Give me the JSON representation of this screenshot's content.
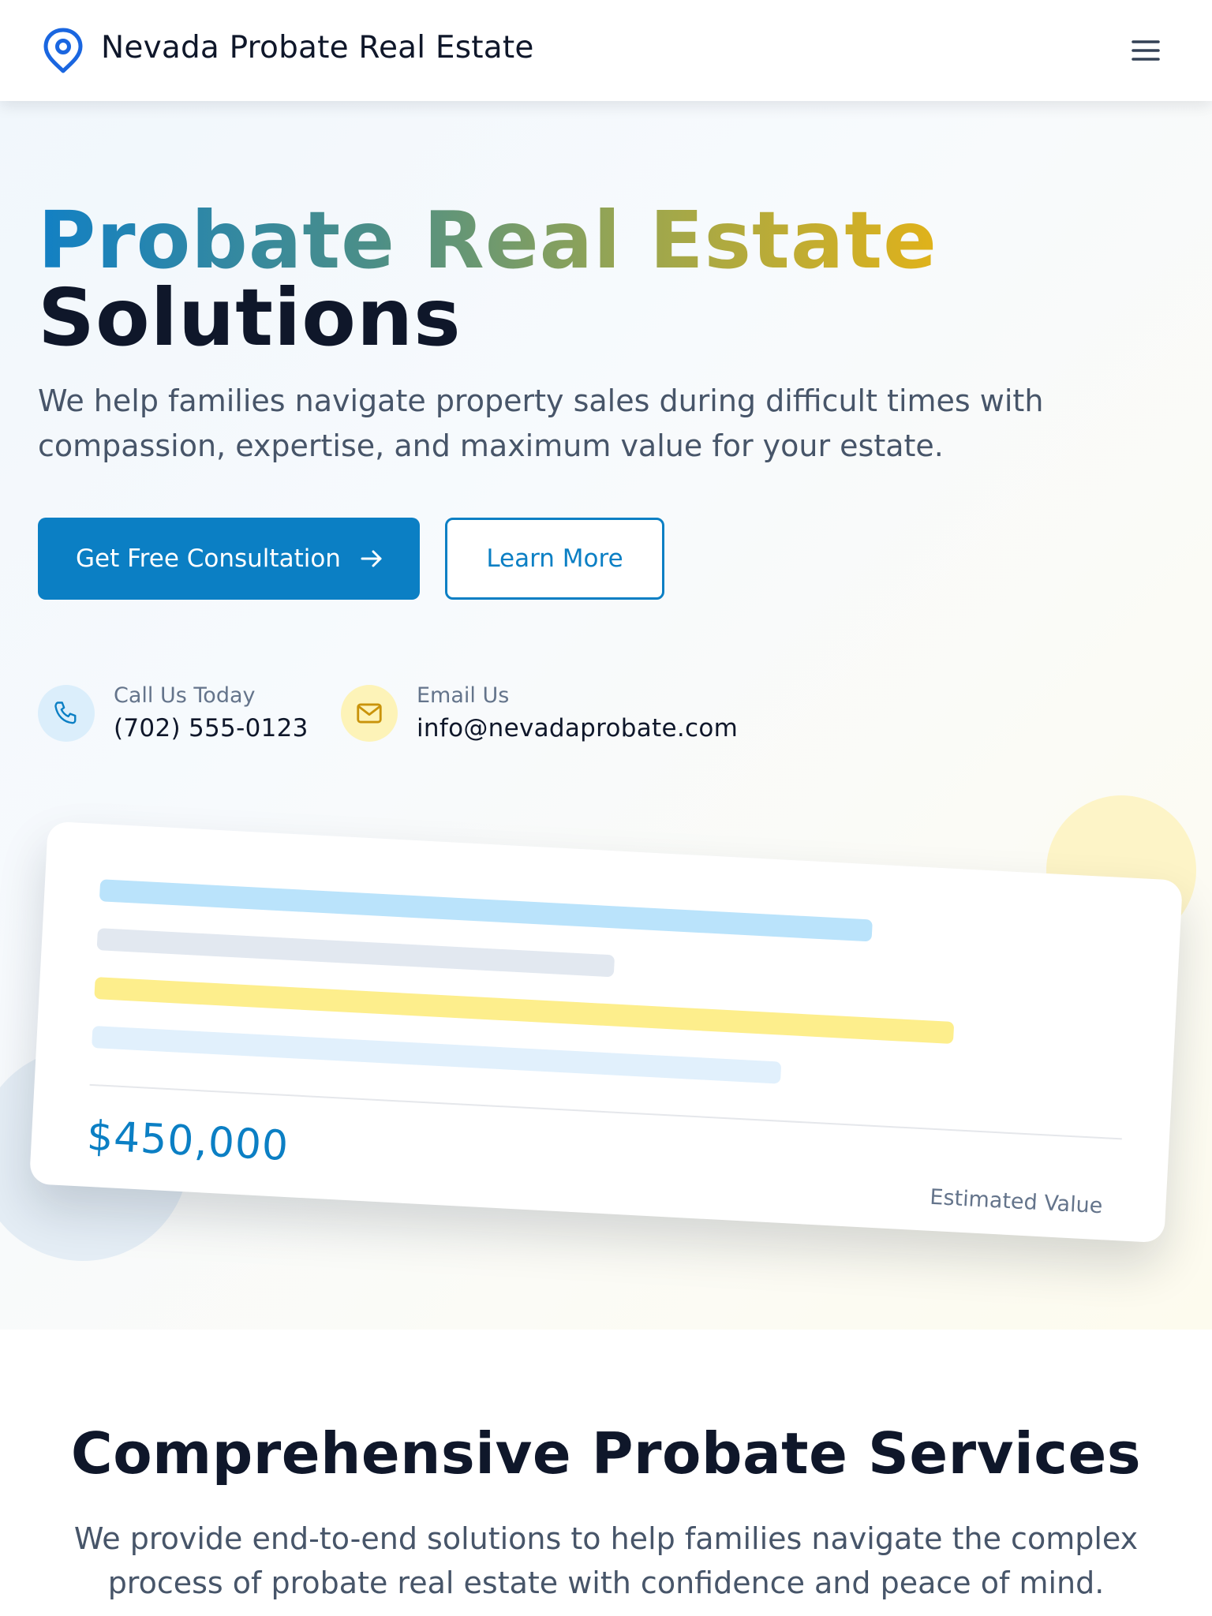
{
  "header": {
    "brand_name": "Nevada Probate Real Estate",
    "brand_icon": "map-pin-icon",
    "menu_icon": "hamburger-menu-icon"
  },
  "hero": {
    "title_highlight": "Probate Real Estate",
    "title_rest": "Solutions",
    "subtitle": "We help families navigate property sales during difficult times with compassion, expertise, and maximum value for your estate.",
    "primary_button": "Get Free Consultation",
    "secondary_button": "Learn More",
    "contacts": {
      "phone_label": "Call Us Today",
      "phone_value": "(702) 555-0123",
      "email_label": "Email Us",
      "email_value": "info@nevadaprobate.com"
    },
    "card": {
      "value": "$450,000",
      "value_label": "Estimated Value"
    }
  },
  "services": {
    "title": "Comprehensive Probate Services",
    "description": "We provide end-to-end solutions to help families navigate the complex process of probate real estate with confidence and peace of mind."
  },
  "colors": {
    "primary": "#0b7fc4",
    "accent_yellow": "#e0b21a",
    "text_dark": "#0f172a",
    "text_muted": "#475569"
  }
}
